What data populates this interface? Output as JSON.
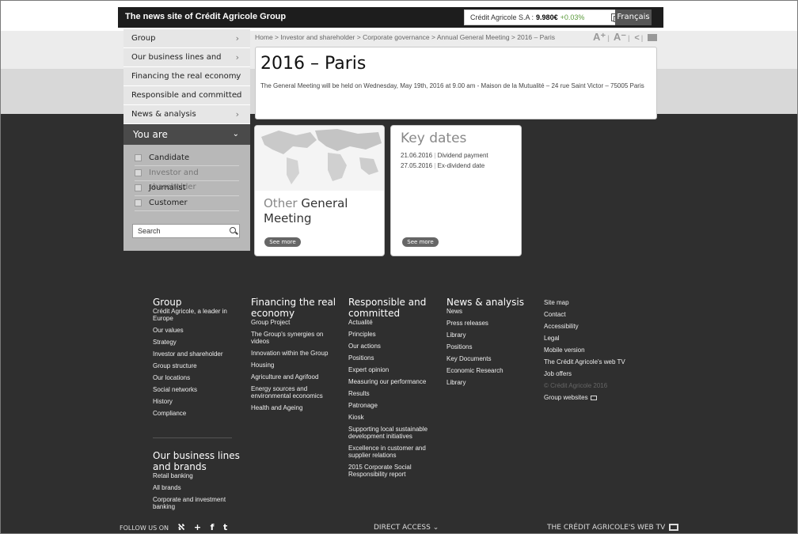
{
  "header": {
    "site_title": "The news site of Crédit Agricole Group",
    "stock_name": "Crédit Agricole S.A :",
    "stock_price": "9.980€",
    "stock_change": "+0.03%",
    "language_button": "Français"
  },
  "sidebar": {
    "items": [
      {
        "label": "Group"
      },
      {
        "label": "Our business lines and brands"
      },
      {
        "label": "Financing the real economy"
      },
      {
        "label": "Responsible and committed"
      },
      {
        "label": "News & analysis"
      }
    ],
    "you_are_label": "You are",
    "profiles": [
      {
        "label": "Candidate",
        "selected": false
      },
      {
        "label": "Investor and shareholder",
        "selected": true
      },
      {
        "label": "Journalist",
        "selected": false
      },
      {
        "label": "Customer",
        "selected": false
      }
    ],
    "search_placeholder": "Search"
  },
  "breadcrumb": "Home > Investor and shareholder > Corporate governance > Annual General Meeting > 2016 – Paris",
  "tools": {
    "font_up": "A⁺",
    "font_down": "A⁻"
  },
  "page": {
    "title": "2016 – Paris",
    "intro": "The General Meeting will be held on Wednesday, May 19th, 2016 at 9.00 am - Maison de la Mutualité – 24 rue Saint Victor – 75005 Paris"
  },
  "cards": {
    "meeting": {
      "title_light": "Other",
      "title_rest": " General Meeting",
      "button": "See more"
    },
    "dates": {
      "title": "Key dates",
      "rows": [
        {
          "date": "21.06.2016",
          "label": "Dividend payment"
        },
        {
          "date": "27.05.2016",
          "label": "Ex-dividend date"
        }
      ],
      "button": "See more"
    }
  },
  "footer": {
    "group": {
      "title": "Group",
      "links": [
        "Crédit Agricole, a leader in Europe",
        "Our values",
        "Strategy",
        "Investor and shareholder",
        "Group structure",
        "Our locations",
        "Social networks",
        "History",
        "Compliance"
      ]
    },
    "financing": {
      "title": "Financing the real economy",
      "links": [
        "Group Project",
        "The Group's synergies on videos",
        "Innovation within the Group",
        "Housing",
        "Agriculture and Agrifood",
        "Energy sources and environmental economics",
        "Health and Ageing"
      ]
    },
    "responsible": {
      "title": "Responsible and committed",
      "links": [
        "Actualité",
        "Principles",
        "Our actions",
        "Positions",
        "Expert opinion",
        "Measuring our performance",
        "Results",
        "Patronage",
        "Kiosk",
        "Supporting local sustainable development initiatives",
        "Excellence in customer and supplier relations",
        "2015 Corporate Social Responsibility report"
      ]
    },
    "news": {
      "title": "News & analysis",
      "links": [
        "News",
        "Press releases",
        "Library",
        "Positions",
        "Key Documents",
        "Economic Research",
        "Library"
      ]
    },
    "site": {
      "links": [
        "Site map",
        "Contact",
        "Accessibility",
        "Legal",
        "Mobile version",
        "The Crédit Agricole's web TV",
        "Job offers"
      ],
      "copyright": "© Crédit Agricole 2016",
      "group_websites": "Group websites"
    },
    "business": {
      "title": "Our business lines and brands",
      "links": [
        "Retail banking",
        "All brands",
        "Corporate and investment banking"
      ]
    },
    "follow_us": "FOLLOW US ON",
    "direct_access": "DIRECT ACCESS",
    "web_tv": "THE CRÉDIT AGRICOLE'S WEB TV"
  }
}
